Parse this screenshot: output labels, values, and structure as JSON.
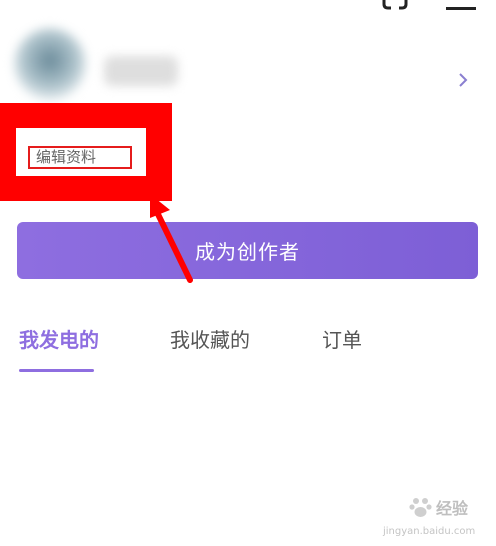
{
  "header": {
    "scan_icon": "scan-icon",
    "menu_icon": "menu-icon"
  },
  "profile": {
    "edit_label": "编辑资料",
    "chevron_icon": "chevron-right-icon"
  },
  "creator_button": {
    "label": "成为创作者"
  },
  "tabs": [
    {
      "label": "我发电的",
      "active": true
    },
    {
      "label": "我收藏的",
      "active": false
    },
    {
      "label": "订单",
      "active": false
    }
  ],
  "watermark": {
    "text": "经验",
    "url": "jingyan.baidu.com"
  },
  "colors": {
    "accent": "#8e6ee0",
    "highlight": "#ff0000"
  }
}
